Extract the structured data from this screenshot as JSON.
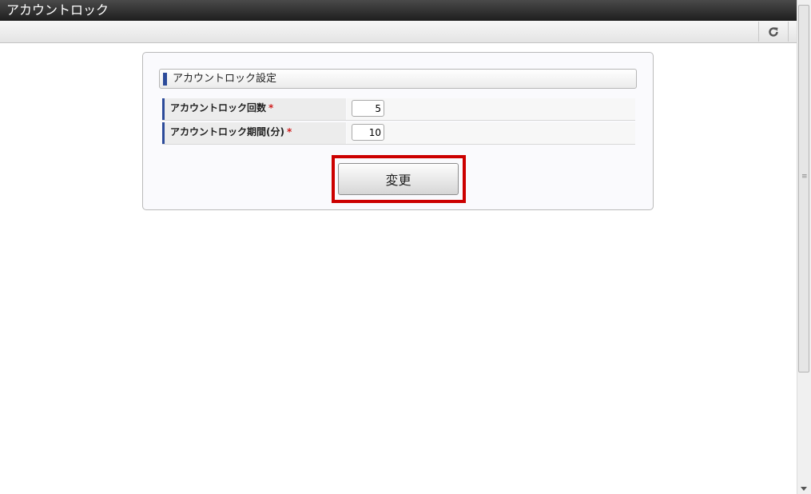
{
  "window": {
    "title": "アカウントロック"
  },
  "toolbar": {
    "refresh_icon": "refresh-icon"
  },
  "section": {
    "title": "アカウントロック設定"
  },
  "fields": [
    {
      "label": "アカウントロック回数",
      "required_mark": "*",
      "value": "5"
    },
    {
      "label": "アカウントロック期間(分)",
      "required_mark": "*",
      "value": "10"
    }
  ],
  "actions": {
    "submit_label": "変更"
  },
  "colors": {
    "accent": "#2c4b9a",
    "required": "#d01f1f",
    "highlight": "#cc0000"
  }
}
